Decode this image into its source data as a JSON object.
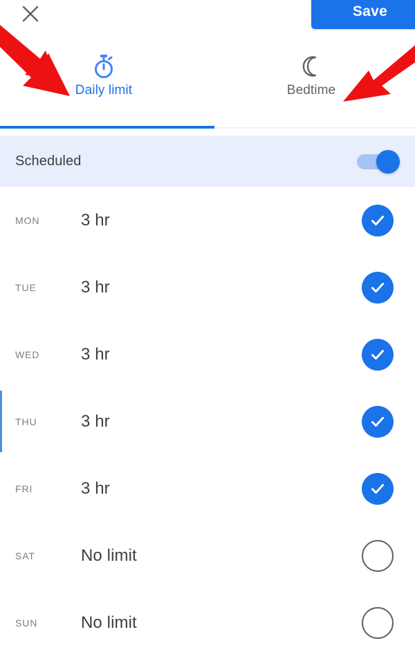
{
  "header": {
    "close_icon": "close-x-icon",
    "save_label": "Save",
    "save_color": "#1a73e8"
  },
  "tabs": [
    {
      "id": "daily-limit",
      "label": "Daily limit",
      "icon": "stopwatch-icon",
      "selected": true,
      "color": "#1a73e8"
    },
    {
      "id": "bedtime",
      "label": "Bedtime",
      "icon": "moon-icon",
      "selected": false,
      "color": "#5f6368"
    }
  ],
  "scheduled": {
    "label": "Scheduled",
    "toggle_state": "on",
    "toggle_icon": "toggle-switch-icon",
    "background_color": "#e8eefc"
  },
  "days": [
    {
      "abbr": "MON",
      "value": "3 hr",
      "checked": true,
      "icon": "check-circle-filled-icon"
    },
    {
      "abbr": "TUE",
      "value": "3 hr",
      "checked": true,
      "icon": "check-circle-filled-icon"
    },
    {
      "abbr": "WED",
      "value": "3 hr",
      "checked": true,
      "icon": "check-circle-filled-icon"
    },
    {
      "abbr": "THU",
      "value": "3 hr",
      "checked": true,
      "icon": "check-circle-filled-icon",
      "marker": true
    },
    {
      "abbr": "FRI",
      "value": "3 hr",
      "checked": true,
      "icon": "check-circle-filled-icon"
    },
    {
      "abbr": "SAT",
      "value": "No limit",
      "checked": false,
      "icon": "circle-outline-icon"
    },
    {
      "abbr": "SUN",
      "value": "No limit",
      "checked": false,
      "icon": "circle-outline-icon"
    }
  ],
  "annotations": {
    "arrow_color": "#ee1111",
    "arrows": [
      {
        "id": "arrow-to-daily-limit-tab",
        "points_to": "daily-limit"
      },
      {
        "id": "arrow-to-bedtime-tab",
        "points_to": "bedtime"
      }
    ]
  }
}
